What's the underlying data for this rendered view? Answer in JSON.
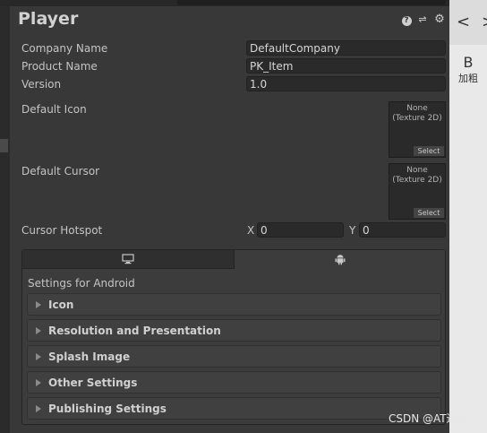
{
  "header": {
    "title": "Player"
  },
  "icons": {
    "help": "help-icon",
    "presets": "sliders-icon",
    "settings": "gear-icon"
  },
  "fields": {
    "company_name": {
      "label": "Company Name",
      "value": "DefaultCompany"
    },
    "product_name": {
      "label": "Product Name",
      "value": "PK_Item"
    },
    "version": {
      "label": "Version",
      "value": "1.0"
    }
  },
  "default_icon": {
    "label": "Default Icon",
    "none_text": "None",
    "type_text": "(Texture 2D)",
    "select_label": "Select"
  },
  "default_cursor": {
    "label": "Default Cursor",
    "none_text": "None",
    "type_text": "(Texture 2D)",
    "select_label": "Select"
  },
  "cursor_hotspot": {
    "label": "Cursor Hotspot",
    "x_label": "X",
    "x_value": "0",
    "y_label": "Y",
    "y_value": "0"
  },
  "platform_tabs": [
    {
      "icon": "monitor-icon",
      "selected": false
    },
    {
      "icon": "android-icon",
      "selected": true
    }
  ],
  "settings_for": "Settings for Android",
  "sections": [
    {
      "label": "Icon"
    },
    {
      "label": "Resolution and Presentation"
    },
    {
      "label": "Splash Image"
    },
    {
      "label": "Other Settings"
    },
    {
      "label": "Publishing Settings"
    }
  ],
  "side_panel": {
    "letter": "B",
    "caption": "加粗"
  },
  "watermark": "CSDN @AT巡礼",
  "colors": {
    "background": "#383838",
    "field": "#2a2a2a",
    "text": "#c4c4c4"
  }
}
